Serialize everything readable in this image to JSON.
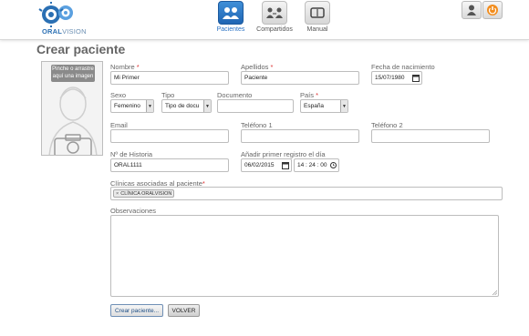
{
  "header": {
    "logo_text_bold": "ORAL",
    "logo_text_light": "VISION",
    "nav": [
      {
        "label": "Pacientes",
        "icon": "patients-icon",
        "active": true
      },
      {
        "label": "Compartidos",
        "icon": "shared-icon",
        "active": false
      },
      {
        "label": "Manual",
        "icon": "manual-icon",
        "active": false
      }
    ],
    "user_icons": [
      "user-avatar-icon",
      "power-icon"
    ]
  },
  "page": {
    "title": "Crear paciente",
    "photo_hint": "Pinche o arrastre aquí una imagen"
  },
  "form": {
    "nombre": {
      "label": "Nombre",
      "required_mark": "*",
      "value": "Mi Primer"
    },
    "apellidos": {
      "label": "Apellidos",
      "required_mark": "*",
      "value": "Paciente"
    },
    "fecha_nacimiento": {
      "label": "Fecha de nacimiento",
      "value": "15/07/1980"
    },
    "sexo": {
      "label": "Sexo",
      "value": "Femenino"
    },
    "tipo": {
      "label": "Tipo",
      "value": "Tipo de docu"
    },
    "documento": {
      "label": "Documento",
      "value": ""
    },
    "pais": {
      "label": "País",
      "required_mark": "*",
      "value": "España"
    },
    "email": {
      "label": "Email",
      "value": ""
    },
    "telefono1": {
      "label": "Teléfono 1",
      "value": ""
    },
    "telefono2": {
      "label": "Teléfono 2",
      "value": ""
    },
    "historia": {
      "label": "Nº de Historia",
      "value": "ORAL1111"
    },
    "primer_registro": {
      "label": "Añadir primer registro el día",
      "date": "06/02/2015",
      "time": "14 : 24 : 00"
    },
    "clinicas": {
      "label": "Clínicas asociadas al paciente",
      "required_mark": "*",
      "chip_remove": "×",
      "chip": "CLÍNICA ORALVISION"
    },
    "observaciones": {
      "label": "Observaciones",
      "value": ""
    }
  },
  "buttons": {
    "create": "Crear paciente...",
    "back": "VOLVER"
  },
  "colors": {
    "accent": "#2a72c4",
    "required": "#d33333",
    "power": "#f28c1c"
  }
}
